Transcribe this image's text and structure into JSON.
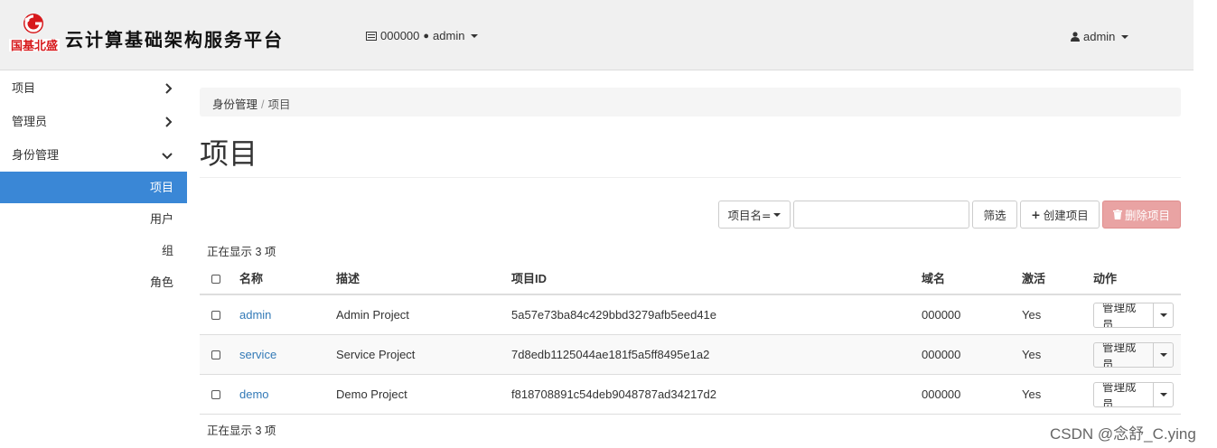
{
  "header": {
    "logo_caption": "国基北盛",
    "app_title": "云计算基础架构服务平台",
    "project_switch": {
      "domain": "000000",
      "project": "admin"
    },
    "user": "admin"
  },
  "sidebar": {
    "groups": [
      {
        "label": "项目",
        "chevron": "right"
      },
      {
        "label": "管理员",
        "chevron": "right"
      },
      {
        "label": "身份管理",
        "chevron": "down"
      }
    ],
    "items": [
      {
        "label": "项目",
        "active": true
      },
      {
        "label": "用户"
      },
      {
        "label": "组"
      },
      {
        "label": "角色"
      }
    ]
  },
  "breadcrumb": {
    "parent": "身份管理",
    "current": "项目"
  },
  "page": {
    "title": "项目"
  },
  "toolbar": {
    "filter_select": "项目名=",
    "filter_value": "",
    "filter_button": "筛选",
    "create_button": "创建项目",
    "delete_button": "删除项目"
  },
  "table": {
    "showing_top": "正在显示 3 项",
    "showing_bottom": "正在显示 3 项",
    "columns": [
      "名称",
      "描述",
      "项目ID",
      "域名",
      "激活",
      "动作"
    ],
    "rows": [
      {
        "name": "admin",
        "description": "Admin Project",
        "id": "5a57e73ba84c429bbd3279afb5eed41e",
        "domain": "000000",
        "enabled": "Yes",
        "action": "管理成员"
      },
      {
        "name": "service",
        "description": "Service Project",
        "id": "7d8edb1125044ae181f5a5ff8495e1a2",
        "domain": "000000",
        "enabled": "Yes",
        "action": "管理成员"
      },
      {
        "name": "demo",
        "description": "Demo Project",
        "id": "f818708891c54deb9048787ad34217d2",
        "domain": "000000",
        "enabled": "Yes",
        "action": "管理成员"
      }
    ]
  },
  "watermark": "CSDN @念舒_C.ying",
  "colors": {
    "accent": "#3a87d6",
    "danger": "#e9a3a3",
    "link": "#337ab7",
    "brand_red": "#d7191c"
  }
}
